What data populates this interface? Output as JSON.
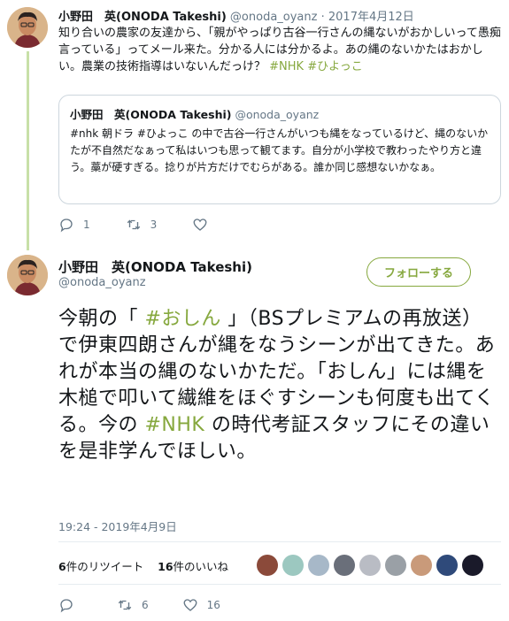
{
  "parent": {
    "name": "小野田　英(ONODA Takeshi)",
    "handle": "@onoda_oyanz",
    "date": "2017年4月12日",
    "text_before": "知り合いの農家の友達から、「親がやっぱり古谷一行さんの縄ないがおかしいって愚痴言っている」ってメール来た。分かる人には分かるよ。あの縄のないかたはおかしい。農業の技術指導はいないんだっけ？ ",
    "hashtag1": "#NHK",
    "hashtag2": "#ひよっこ",
    "quote": {
      "name": "小野田　英(ONODA Takeshi)",
      "handle": "@onoda_oyanz",
      "text": "#nhk 朝ドラ #ひよっこ の中で古谷一行さんがいつも縄をなっているけど、縄のないかたが不自然だなぁって私はいつも思って観てます。自分が小学校で教わったやり方と違う。藁が硬すぎる。捻りが片方だけでむらがある。誰か同じ感想ないかなぁ。"
    },
    "replies": "1",
    "retweets": "3",
    "likes": ""
  },
  "main": {
    "name": "小野田　英(ONODA Takeshi)",
    "handle": "@onoda_oyanz",
    "follow_label": "フォローする",
    "text_part1": "今朝の「 ",
    "hashtag_oshin": "#おしん",
    "text_part2": " 」（BSプレミアムの再放送）で伊東四朗さんが縄をなうシーンが出てきた。あれが本当の縄のないかただ。「おしん」には縄を木槌で叩いて繊維をほぐすシーンも何度も出てくる。今の ",
    "hashtag_nhk": "#NHK",
    "text_part3": " の時代考証スタッフにその違いを是非学んでほしい。",
    "timestamp": "19:24 - 2019年4月9日",
    "retweet_count": "6",
    "retweet_label": "件のリツイート",
    "like_count": "16",
    "like_label": "件のいいね",
    "replies": "",
    "retweets": "6",
    "likes": "16"
  },
  "icons": [
    "reply-icon",
    "retweet-icon",
    "like-icon"
  ],
  "colors": {
    "accent": "#86a83e",
    "thread_line": "#c8e0a8",
    "muted": "#657786",
    "border": "#ccd6dd",
    "text": "#14171a"
  }
}
